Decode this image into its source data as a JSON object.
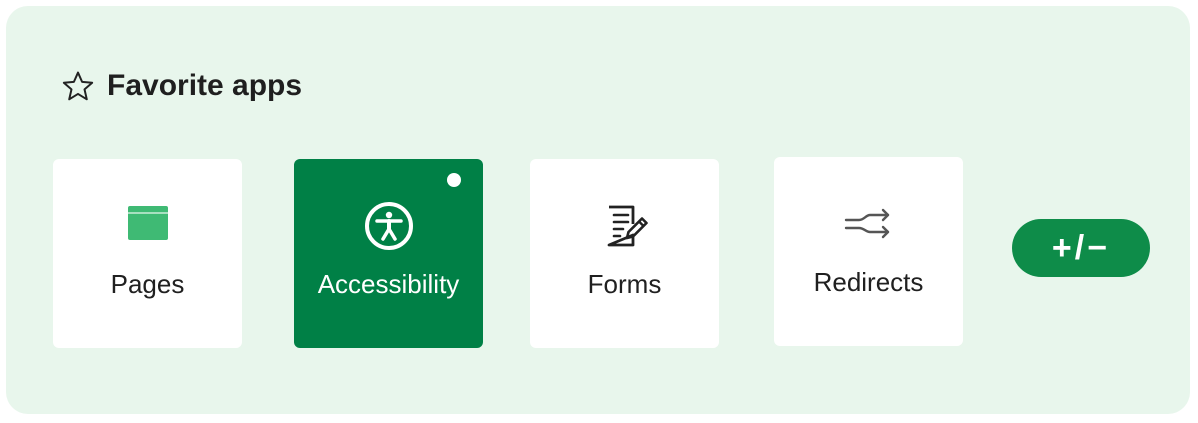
{
  "section": {
    "title": "Favorite apps",
    "icon": "star-outline-icon"
  },
  "apps": [
    {
      "label": "Pages",
      "icon": "pages-icon",
      "selected": false
    },
    {
      "label": "Accessibility",
      "icon": "accessibility-icon",
      "selected": true,
      "indicator": true
    },
    {
      "label": "Forms",
      "icon": "forms-icon",
      "selected": false
    },
    {
      "label": "Redirects",
      "icon": "redirects-icon",
      "selected": false
    }
  ],
  "edit_button": {
    "label": "+/−"
  },
  "colors": {
    "panel_background": "#e8f6ec",
    "accent": "#008046",
    "pages_icon": "#3fba74"
  }
}
